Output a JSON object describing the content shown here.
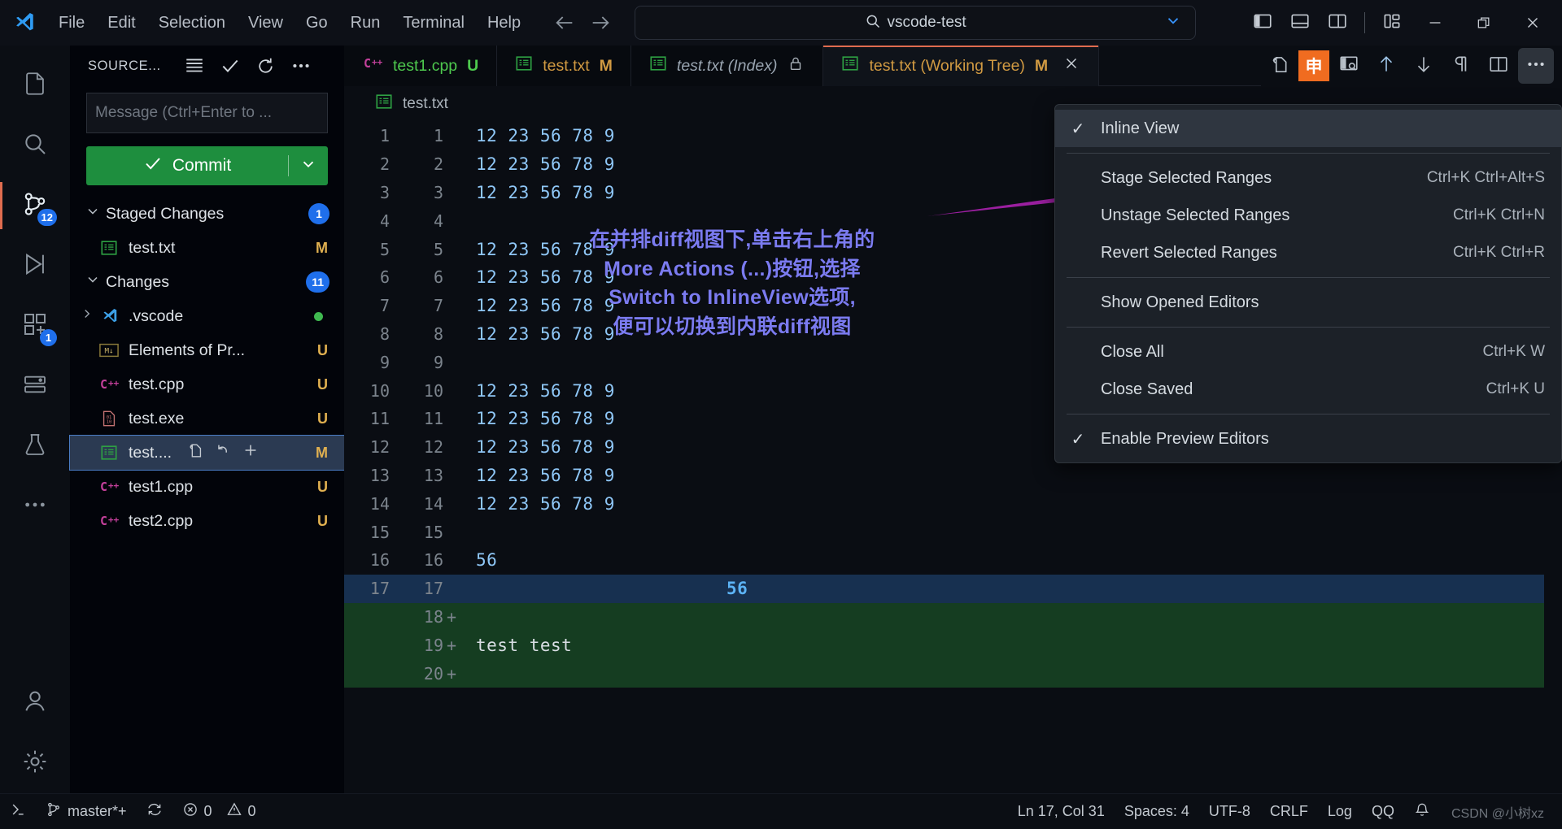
{
  "titlebar": {
    "logo_icon": "vscode-logo-icon",
    "menus": [
      "File",
      "Edit",
      "Selection",
      "View",
      "Go",
      "Run",
      "Terminal",
      "Help"
    ],
    "nav_back_icon": "arrow-left-icon",
    "nav_forward_icon": "arrow-right-icon",
    "quickinput": {
      "search_icon": "search-icon",
      "value": "vscode-test",
      "chevron_icon": "chevron-down-icon"
    },
    "layout_buttons": [
      {
        "name": "toggle-primary-sidebar",
        "icon": "layout-sidebar-left-icon"
      },
      {
        "name": "toggle-panel",
        "icon": "layout-panel-icon"
      },
      {
        "name": "toggle-secondary-sidebar",
        "icon": "layout-sidebar-right-icon"
      },
      {
        "name": "customize-layout",
        "icon": "layout-customize-icon"
      }
    ],
    "window_controls": [
      {
        "name": "minimize-button",
        "glyph": "—"
      },
      {
        "name": "restore-button",
        "glyph": "❐"
      },
      {
        "name": "close-button",
        "glyph": "✕"
      }
    ]
  },
  "activitybar": {
    "items": [
      {
        "name": "explorer",
        "icon": "files-icon",
        "badge": null,
        "active": false
      },
      {
        "name": "search",
        "icon": "search-icon",
        "badge": null,
        "active": false
      },
      {
        "name": "source-control",
        "icon": "source-control-icon",
        "badge": "12",
        "active": true
      },
      {
        "name": "run-and-debug",
        "icon": "debug-icon",
        "badge": null,
        "active": false
      },
      {
        "name": "extensions",
        "icon": "extensions-icon",
        "badge": "1",
        "active": false
      },
      {
        "name": "remote-explorer",
        "icon": "remote-icon",
        "badge": null,
        "active": false
      },
      {
        "name": "test-explorer",
        "icon": "beaker-icon",
        "badge": null,
        "active": false
      },
      {
        "name": "more-views",
        "icon": "ellipsis-icon",
        "badge": null,
        "active": false
      }
    ],
    "bottom": [
      {
        "name": "accounts",
        "icon": "account-icon"
      },
      {
        "name": "manage-settings",
        "icon": "gear-icon"
      }
    ]
  },
  "sidebar": {
    "title": "SOURCE...",
    "header_actions": [
      {
        "name": "view-as-list-button",
        "icon": "list-flat-icon"
      },
      {
        "name": "commit-button",
        "icon": "check-icon"
      },
      {
        "name": "refresh-button",
        "icon": "refresh-icon"
      },
      {
        "name": "more-actions-button",
        "icon": "ellipsis-icon"
      }
    ],
    "commit_message_placeholder": "Message (Ctrl+Enter to ...",
    "commit_message_value": "",
    "commit_button_label": "Commit",
    "commit_check_icon": "check-icon",
    "commit_dropdown_icon": "chevron-down-icon",
    "groups": [
      {
        "name": "Staged Changes",
        "count": "1",
        "expanded": true,
        "files": [
          {
            "label": "test.txt",
            "icon": "text-file-icon",
            "status": "M",
            "selected": false,
            "folder": false
          }
        ]
      },
      {
        "name": "Changes",
        "count": "11",
        "expanded": true,
        "files": [
          {
            "label": ".vscode",
            "icon": "vscode-folder-icon",
            "status": "",
            "selected": false,
            "folder": true,
            "dot": true
          },
          {
            "label": "Elements of Pr...",
            "icon": "markdown-file-icon",
            "status": "U",
            "selected": false,
            "folder": false
          },
          {
            "label": "test.cpp",
            "icon": "cpp-file-icon",
            "status": "U",
            "selected": false,
            "folder": false
          },
          {
            "label": "test.exe",
            "icon": "binary-file-icon",
            "status": "U",
            "selected": false,
            "folder": false
          },
          {
            "label": "test....",
            "icon": "text-file-icon",
            "status": "M",
            "selected": true,
            "folder": false,
            "actions": [
              {
                "name": "open-file-button",
                "icon": "open-file-icon"
              },
              {
                "name": "discard-changes-button",
                "icon": "discard-icon"
              },
              {
                "name": "stage-changes-button",
                "icon": "plus-icon"
              }
            ]
          },
          {
            "label": "test1.cpp",
            "icon": "cpp-file-icon",
            "status": "U",
            "selected": false,
            "folder": false
          },
          {
            "label": "test2.cpp",
            "icon": "cpp-file-icon",
            "status": "U",
            "selected": false,
            "folder": false
          }
        ]
      }
    ]
  },
  "editor": {
    "tabs": [
      {
        "label": "test1.cpp",
        "icon": "cpp-file-icon",
        "status": "U",
        "active": false,
        "style": "green",
        "lock": false,
        "closable": false
      },
      {
        "label": "test.txt",
        "icon": "text-file-icon",
        "status": "M",
        "active": false,
        "style": "orange",
        "lock": false,
        "closable": false
      },
      {
        "label": "test.txt (Index)",
        "icon": "text-file-icon",
        "status": "",
        "active": false,
        "style": "grey-i",
        "lock": true,
        "closable": false
      },
      {
        "label": "test.txt (Working Tree)",
        "icon": "text-file-icon",
        "status": "M",
        "active": true,
        "style": "orange",
        "lock": false,
        "closable": true
      }
    ],
    "tab_close_icon": "close-icon",
    "tab_lock_icon": "lock-icon",
    "toolbar": [
      {
        "name": "open-changes-button",
        "icon": "open-changes-icon"
      },
      {
        "name": "ime-indicator",
        "icon": "ime-chinese-icon",
        "glyph": "申"
      },
      {
        "name": "open-file-preview-button",
        "icon": "file-preview-icon"
      },
      {
        "name": "previous-change-button",
        "icon": "arrow-up-icon"
      },
      {
        "name": "next-change-button",
        "icon": "arrow-down-icon"
      },
      {
        "name": "toggle-whitespace-button",
        "icon": "pilcrow-icon"
      },
      {
        "name": "split-editor-button",
        "icon": "split-editor-icon"
      },
      {
        "name": "more-actions-button",
        "icon": "ellipsis-icon"
      }
    ],
    "breadcrumb": {
      "icon": "text-file-icon",
      "label": "test.txt"
    },
    "diff_lines": [
      {
        "left": "1",
        "right": "1",
        "text": "12 23 56 78 9",
        "type": "ctx"
      },
      {
        "left": "2",
        "right": "2",
        "text": "12 23 56 78 9",
        "type": "ctx"
      },
      {
        "left": "3",
        "right": "3",
        "text": "12 23 56 78 9",
        "type": "ctx"
      },
      {
        "left": "4",
        "right": "4",
        "text": "",
        "type": "ctx"
      },
      {
        "left": "5",
        "right": "5",
        "text": "12 23 56 78 9",
        "type": "ctx"
      },
      {
        "left": "6",
        "right": "6",
        "text": "12 23 56 78 9",
        "type": "ctx"
      },
      {
        "left": "7",
        "right": "7",
        "text": "12 23 56 78 9",
        "type": "ctx"
      },
      {
        "left": "8",
        "right": "8",
        "text": "12 23 56 78 9",
        "type": "ctx"
      },
      {
        "left": "9",
        "right": "9",
        "text": "",
        "type": "ctx"
      },
      {
        "left": "10",
        "right": "10",
        "text": "12 23 56 78 9",
        "type": "ctx"
      },
      {
        "left": "11",
        "right": "11",
        "text": "12 23 56 78 9",
        "type": "ctx"
      },
      {
        "left": "12",
        "right": "12",
        "text": "12 23 56 78 9",
        "type": "ctx"
      },
      {
        "left": "13",
        "right": "13",
        "text": "12 23 56 78 9",
        "type": "ctx"
      },
      {
        "left": "14",
        "right": "14",
        "text": "12 23 56 78 9",
        "type": "ctx"
      },
      {
        "left": "15",
        "right": "15",
        "text": "",
        "type": "ctx"
      },
      {
        "left": "16",
        "right": "16",
        "text": "56",
        "type": "ctx"
      },
      {
        "left": "17",
        "right": "17",
        "text": "56",
        "type": "cursor"
      },
      {
        "left": "",
        "right": "18",
        "text": "",
        "type": "added"
      },
      {
        "left": "",
        "right": "19",
        "text": "test test",
        "type": "added"
      },
      {
        "left": "",
        "right": "20",
        "text": "",
        "type": "added"
      }
    ]
  },
  "context_menu": {
    "items": [
      {
        "label": "Inline View",
        "keybinding": "",
        "checked": true,
        "highlighted": true,
        "type": "item"
      },
      {
        "type": "separator"
      },
      {
        "label": "Stage Selected Ranges",
        "keybinding": "Ctrl+K Ctrl+Alt+S",
        "checked": false,
        "type": "item"
      },
      {
        "label": "Unstage Selected Ranges",
        "keybinding": "Ctrl+K Ctrl+N",
        "checked": false,
        "type": "item"
      },
      {
        "label": "Revert Selected Ranges",
        "keybinding": "Ctrl+K Ctrl+R",
        "checked": false,
        "type": "item"
      },
      {
        "type": "separator"
      },
      {
        "label": "Show Opened Editors",
        "keybinding": "",
        "checked": false,
        "type": "item"
      },
      {
        "type": "separator"
      },
      {
        "label": "Close All",
        "keybinding": "Ctrl+K W",
        "checked": false,
        "type": "item"
      },
      {
        "label": "Close Saved",
        "keybinding": "Ctrl+K U",
        "checked": false,
        "type": "item"
      },
      {
        "type": "separator"
      },
      {
        "label": "Enable Preview Editors",
        "keybinding": "",
        "checked": true,
        "type": "item"
      }
    ]
  },
  "annotation": {
    "color": "#7b7bf0",
    "lines": [
      "在并排diff视图下,单击右上角的",
      "More Actions (...)按钮,选择",
      "Switch to InlineView选项,",
      "便可以切换到内联diff视图"
    ],
    "arrow_color": "#9b1fa0"
  },
  "statusbar": {
    "left": [
      {
        "name": "remote-indicator",
        "icon": "remote-icon",
        "label": ""
      },
      {
        "name": "branch-indicator",
        "icon": "branch-icon",
        "label": "master*+"
      },
      {
        "name": "sync-changes",
        "icon": "sync-icon",
        "label": ""
      },
      {
        "name": "problems-errors",
        "icon": "error-icon",
        "label": "0"
      },
      {
        "name": "problems-warnings",
        "icon": "warning-icon",
        "label": "0"
      }
    ],
    "right": [
      {
        "name": "cursor-position",
        "label": "Ln 17, Col 31"
      },
      {
        "name": "indentation",
        "label": "Spaces: 4"
      },
      {
        "name": "encoding",
        "label": "UTF-8"
      },
      {
        "name": "eol",
        "label": "CRLF"
      },
      {
        "name": "language-mode",
        "label": "Log"
      },
      {
        "name": "qq-status",
        "label": "QQ"
      },
      {
        "name": "notifications",
        "icon": "bell-icon",
        "label": ""
      }
    ],
    "watermark": "CSDN @小树xz"
  }
}
